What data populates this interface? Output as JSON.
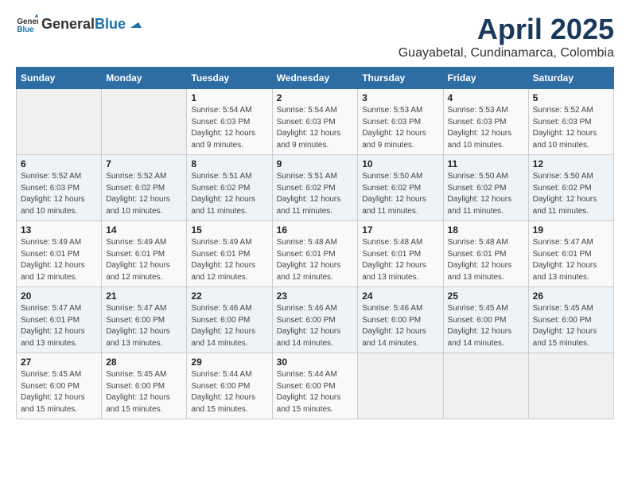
{
  "header": {
    "logo_general": "General",
    "logo_blue": "Blue",
    "month_year": "April 2025",
    "location": "Guayabetal, Cundinamarca, Colombia"
  },
  "weekdays": [
    "Sunday",
    "Monday",
    "Tuesday",
    "Wednesday",
    "Thursday",
    "Friday",
    "Saturday"
  ],
  "weeks": [
    [
      {
        "day": "",
        "info": ""
      },
      {
        "day": "",
        "info": ""
      },
      {
        "day": "1",
        "info": "Sunrise: 5:54 AM\nSunset: 6:03 PM\nDaylight: 12 hours and 9 minutes."
      },
      {
        "day": "2",
        "info": "Sunrise: 5:54 AM\nSunset: 6:03 PM\nDaylight: 12 hours and 9 minutes."
      },
      {
        "day": "3",
        "info": "Sunrise: 5:53 AM\nSunset: 6:03 PM\nDaylight: 12 hours and 9 minutes."
      },
      {
        "day": "4",
        "info": "Sunrise: 5:53 AM\nSunset: 6:03 PM\nDaylight: 12 hours and 10 minutes."
      },
      {
        "day": "5",
        "info": "Sunrise: 5:52 AM\nSunset: 6:03 PM\nDaylight: 12 hours and 10 minutes."
      }
    ],
    [
      {
        "day": "6",
        "info": "Sunrise: 5:52 AM\nSunset: 6:03 PM\nDaylight: 12 hours and 10 minutes."
      },
      {
        "day": "7",
        "info": "Sunrise: 5:52 AM\nSunset: 6:02 PM\nDaylight: 12 hours and 10 minutes."
      },
      {
        "day": "8",
        "info": "Sunrise: 5:51 AM\nSunset: 6:02 PM\nDaylight: 12 hours and 11 minutes."
      },
      {
        "day": "9",
        "info": "Sunrise: 5:51 AM\nSunset: 6:02 PM\nDaylight: 12 hours and 11 minutes."
      },
      {
        "day": "10",
        "info": "Sunrise: 5:50 AM\nSunset: 6:02 PM\nDaylight: 12 hours and 11 minutes."
      },
      {
        "day": "11",
        "info": "Sunrise: 5:50 AM\nSunset: 6:02 PM\nDaylight: 12 hours and 11 minutes."
      },
      {
        "day": "12",
        "info": "Sunrise: 5:50 AM\nSunset: 6:02 PM\nDaylight: 12 hours and 11 minutes."
      }
    ],
    [
      {
        "day": "13",
        "info": "Sunrise: 5:49 AM\nSunset: 6:01 PM\nDaylight: 12 hours and 12 minutes."
      },
      {
        "day": "14",
        "info": "Sunrise: 5:49 AM\nSunset: 6:01 PM\nDaylight: 12 hours and 12 minutes."
      },
      {
        "day": "15",
        "info": "Sunrise: 5:49 AM\nSunset: 6:01 PM\nDaylight: 12 hours and 12 minutes."
      },
      {
        "day": "16",
        "info": "Sunrise: 5:48 AM\nSunset: 6:01 PM\nDaylight: 12 hours and 12 minutes."
      },
      {
        "day": "17",
        "info": "Sunrise: 5:48 AM\nSunset: 6:01 PM\nDaylight: 12 hours and 13 minutes."
      },
      {
        "day": "18",
        "info": "Sunrise: 5:48 AM\nSunset: 6:01 PM\nDaylight: 12 hours and 13 minutes."
      },
      {
        "day": "19",
        "info": "Sunrise: 5:47 AM\nSunset: 6:01 PM\nDaylight: 12 hours and 13 minutes."
      }
    ],
    [
      {
        "day": "20",
        "info": "Sunrise: 5:47 AM\nSunset: 6:01 PM\nDaylight: 12 hours and 13 minutes."
      },
      {
        "day": "21",
        "info": "Sunrise: 5:47 AM\nSunset: 6:00 PM\nDaylight: 12 hours and 13 minutes."
      },
      {
        "day": "22",
        "info": "Sunrise: 5:46 AM\nSunset: 6:00 PM\nDaylight: 12 hours and 14 minutes."
      },
      {
        "day": "23",
        "info": "Sunrise: 5:46 AM\nSunset: 6:00 PM\nDaylight: 12 hours and 14 minutes."
      },
      {
        "day": "24",
        "info": "Sunrise: 5:46 AM\nSunset: 6:00 PM\nDaylight: 12 hours and 14 minutes."
      },
      {
        "day": "25",
        "info": "Sunrise: 5:45 AM\nSunset: 6:00 PM\nDaylight: 12 hours and 14 minutes."
      },
      {
        "day": "26",
        "info": "Sunrise: 5:45 AM\nSunset: 6:00 PM\nDaylight: 12 hours and 15 minutes."
      }
    ],
    [
      {
        "day": "27",
        "info": "Sunrise: 5:45 AM\nSunset: 6:00 PM\nDaylight: 12 hours and 15 minutes."
      },
      {
        "day": "28",
        "info": "Sunrise: 5:45 AM\nSunset: 6:00 PM\nDaylight: 12 hours and 15 minutes."
      },
      {
        "day": "29",
        "info": "Sunrise: 5:44 AM\nSunset: 6:00 PM\nDaylight: 12 hours and 15 minutes."
      },
      {
        "day": "30",
        "info": "Sunrise: 5:44 AM\nSunset: 6:00 PM\nDaylight: 12 hours and 15 minutes."
      },
      {
        "day": "",
        "info": ""
      },
      {
        "day": "",
        "info": ""
      },
      {
        "day": "",
        "info": ""
      }
    ]
  ]
}
